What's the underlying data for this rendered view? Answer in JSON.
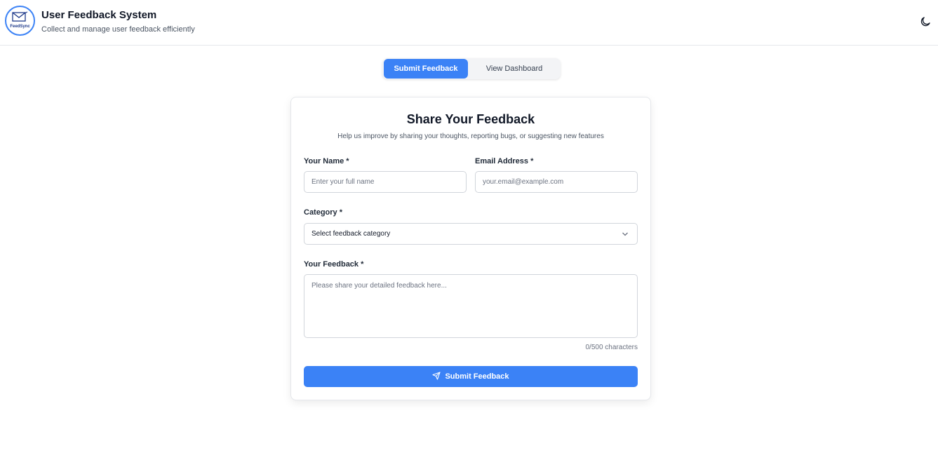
{
  "header": {
    "logo_text": "FeedSync",
    "title": "User Feedback System",
    "subtitle": "Collect and manage user feedback efficiently",
    "theme_icon": "moon-icon"
  },
  "tabs": [
    {
      "label": "Submit Feedback",
      "active": true
    },
    {
      "label": "View Dashboard",
      "active": false
    }
  ],
  "form": {
    "title": "Share Your Feedback",
    "subtitle": "Help us improve by sharing your thoughts, reporting bugs, or suggesting new features",
    "name_label": "Your Name *",
    "name_placeholder": "Enter your full name",
    "email_label": "Email Address *",
    "email_placeholder": "your.email@example.com",
    "category_label": "Category *",
    "category_selected": "Select feedback category",
    "feedback_label": "Your Feedback *",
    "feedback_placeholder": "Please share your detailed feedback here...",
    "char_count": "0/500 characters",
    "submit_label": "Submit Feedback",
    "submit_icon": "send-icon"
  },
  "colors": {
    "accent": "#3b82f6",
    "border": "#d1d5db",
    "text": "#111827"
  }
}
